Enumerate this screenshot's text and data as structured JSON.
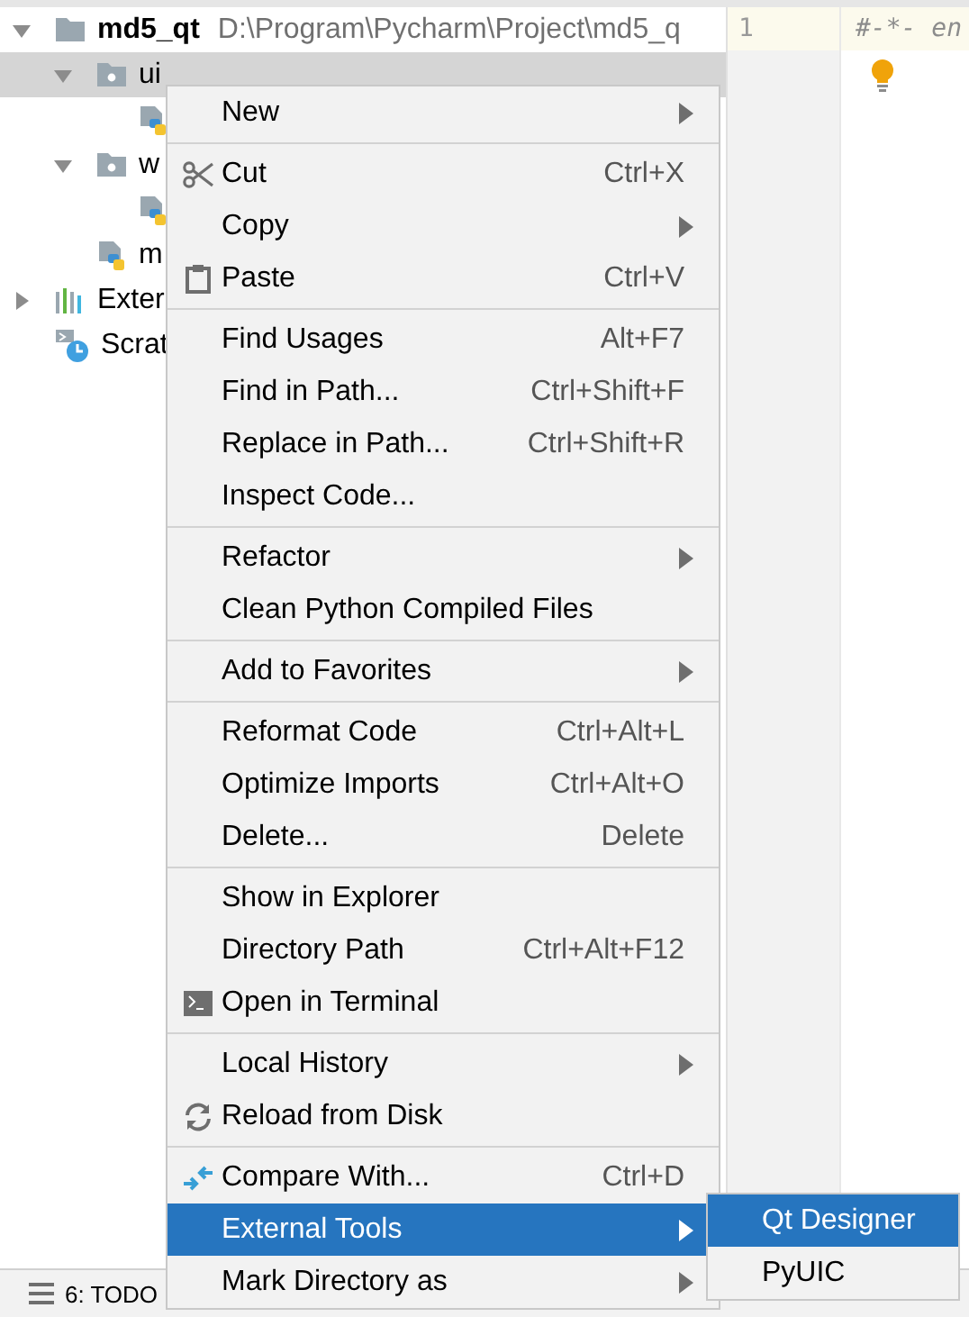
{
  "tree": [
    {
      "label": "md5_qt",
      "path": "D:\\Program\\Pycharm\\Project\\md5_q",
      "kind": "project-folder",
      "expanded": true,
      "selected": false,
      "children": [
        {
          "label": "ui",
          "kind": "package",
          "expanded": true,
          "selected": true,
          "children": [
            {
              "kind": "python-file",
              "selected": false
            }
          ]
        },
        {
          "label": "w",
          "kind": "package",
          "expanded": true,
          "selected": false,
          "children": [
            {
              "kind": "python-file",
              "selected": false
            }
          ]
        },
        {
          "label": "m",
          "kind": "python-file",
          "selected": false
        }
      ]
    },
    {
      "label": "Exter",
      "kind": "libraries",
      "expanded": false,
      "selected": false
    },
    {
      "label": "Scrat",
      "kind": "scratches",
      "selected": false
    }
  ],
  "editor": {
    "line_number": "1",
    "code": "#-*- en"
  },
  "tool_tab": {
    "label": "6: TODO"
  },
  "context_menu": [
    {
      "kind": "item",
      "label": "New",
      "submenu": true,
      "selected": false
    },
    {
      "kind": "separator"
    },
    {
      "kind": "scissors",
      "label": "Cut",
      "shortcut": "Ctrl+X",
      "selected": false
    },
    {
      "kind": "item",
      "label": "Copy",
      "submenu": true,
      "selected": false
    },
    {
      "kind": "clipboard",
      "label": "Paste",
      "shortcut": "Ctrl+V",
      "selected": false
    },
    {
      "kind": "separator"
    },
    {
      "kind": "item",
      "label": "Find Usages",
      "shortcut": "Alt+F7",
      "selected": false
    },
    {
      "kind": "item",
      "label": "Find in Path...",
      "shortcut": "Ctrl+Shift+F",
      "selected": false
    },
    {
      "kind": "item",
      "label": "Replace in Path...",
      "shortcut": "Ctrl+Shift+R",
      "selected": false
    },
    {
      "kind": "item",
      "label": "Inspect Code...",
      "selected": false
    },
    {
      "kind": "separator"
    },
    {
      "kind": "item",
      "label": "Refactor",
      "submenu": true,
      "selected": false
    },
    {
      "kind": "item",
      "label": "Clean Python Compiled Files",
      "selected": false
    },
    {
      "kind": "separator"
    },
    {
      "kind": "item",
      "label": "Add to Favorites",
      "submenu": true,
      "selected": false
    },
    {
      "kind": "separator"
    },
    {
      "kind": "item",
      "label": "Reformat Code",
      "shortcut": "Ctrl+Alt+L",
      "selected": false
    },
    {
      "kind": "item",
      "label": "Optimize Imports",
      "shortcut": "Ctrl+Alt+O",
      "selected": false
    },
    {
      "kind": "item",
      "label": "Delete...",
      "shortcut": "Delete",
      "selected": false
    },
    {
      "kind": "separator"
    },
    {
      "kind": "item",
      "label": "Show in Explorer",
      "selected": false
    },
    {
      "kind": "item",
      "label": "Directory Path",
      "shortcut": "Ctrl+Alt+F12",
      "selected": false
    },
    {
      "kind": "terminal",
      "label": "Open in Terminal",
      "selected": false
    },
    {
      "kind": "separator"
    },
    {
      "kind": "item",
      "label": "Local History",
      "submenu": true,
      "selected": false
    },
    {
      "kind": "reload",
      "label": "Reload from Disk",
      "selected": false
    },
    {
      "kind": "separator"
    },
    {
      "kind": "compare",
      "label": "Compare With...",
      "shortcut": "Ctrl+D",
      "selected": false
    },
    {
      "kind": "item",
      "label": "External Tools",
      "submenu": true,
      "selected": true
    },
    {
      "kind": "item",
      "label": "Mark Directory as",
      "submenu": true,
      "selected": false
    }
  ],
  "submenu": [
    {
      "label": "Qt Designer",
      "selected": true
    },
    {
      "label": "PyUIC",
      "selected": false
    }
  ]
}
